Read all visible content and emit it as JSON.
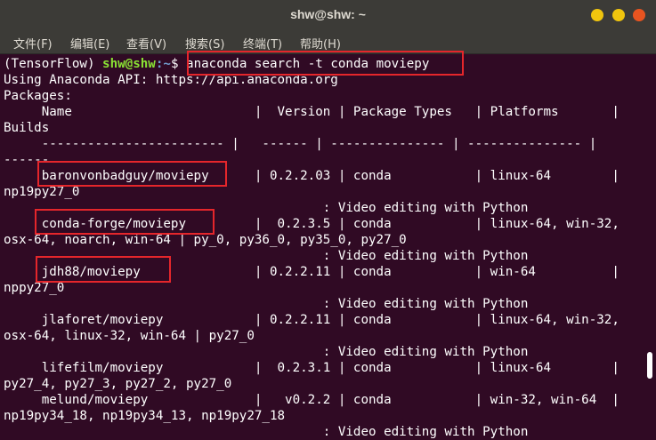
{
  "window": {
    "title": "shw@shw: ~"
  },
  "menu": [
    "文件(F)",
    "编辑(E)",
    "查看(V)",
    "搜索(S)",
    "终端(T)",
    "帮助(H)"
  ],
  "prompt": {
    "env": "(TensorFlow) ",
    "user": "shw@shw",
    "path": ":~",
    "sym": "$ ",
    "command": "anaconda search -t conda moviepy"
  },
  "lines": [
    "Using Anaconda API: https://api.anaconda.org",
    "Packages:",
    "     Name                        |  Version | Package Types   | Platforms       |",
    "Builds",
    "     ------------------------ |   ------ | --------------- | --------------- |",
    "------",
    "     baronvonbadguy/moviepy      | 0.2.2.03 | conda           | linux-64        |",
    "np19py27_0",
    "                                          : Video editing with Python",
    "     conda-forge/moviepy         |  0.2.3.5 | conda           | linux-64, win-32,",
    "osx-64, noarch, win-64 | py_0, py36_0, py35_0, py27_0",
    "                                          : Video editing with Python",
    "     jdh88/moviepy               | 0.2.2.11 | conda           | win-64          |",
    "nppy27_0",
    "                                          : Video editing with Python",
    "     jlaforet/moviepy            | 0.2.2.11 | conda           | linux-64, win-32,",
    "osx-64, linux-32, win-64 | py27_0",
    "                                          : Video editing with Python",
    "     lifefilm/moviepy            |  0.2.3.1 | conda           | linux-64        |",
    "py27_4, py27_3, py27_2, py27_0",
    "     melund/moviepy              |   v0.2.2 | conda           | win-32, win-64  |",
    "np19py34_18, np19py34_13, np19py27_18",
    "                                          : Video editing with Python"
  ],
  "colors": {
    "highlight": "#e5262b",
    "prompt_user": "#8ae234",
    "prompt_path": "#729fcf",
    "close_button": "#e95420",
    "window_button": "#f0c50e"
  }
}
